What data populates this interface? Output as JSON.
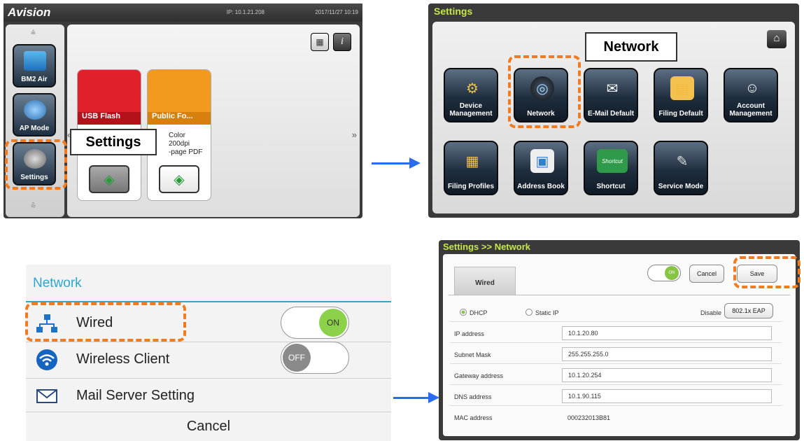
{
  "panel1": {
    "logo": "Avision",
    "ip": "IP: 10.1.21.208",
    "datetime": "2017/11/27 10:19",
    "sidebar": [
      {
        "label": "BM2 Air"
      },
      {
        "label": "AP Mode"
      },
      {
        "label": "Settings"
      }
    ],
    "tiles": [
      {
        "title": "USB Flash",
        "color": "#e0202a"
      },
      {
        "title": "Public Fo...",
        "color": "#f29a1e",
        "details": [
          "Color",
          "200dpi",
          "-page PDF"
        ]
      }
    ],
    "callout": "Settings",
    "nav_left": "«",
    "nav_right": "»"
  },
  "panel2": {
    "title": "Settings",
    "callout": "Network",
    "icons": [
      {
        "label": "Device Management",
        "glyph": "⚙"
      },
      {
        "label": "Network",
        "glyph": "◎"
      },
      {
        "label": "E-Mail Default",
        "glyph": "✉"
      },
      {
        "label": "Filing Default",
        "glyph": "▤"
      },
      {
        "label": "Account Management",
        "glyph": "☺"
      },
      {
        "label": "Filing Profiles",
        "glyph": "▦"
      },
      {
        "label": "Address Book",
        "glyph": "▣"
      },
      {
        "label": "Shortcut",
        "glyph": "➜",
        "sign": "Shortcut"
      },
      {
        "label": "Service Mode",
        "glyph": "✎"
      }
    ]
  },
  "panel3": {
    "title": "Network",
    "rows": [
      {
        "label": "Wired",
        "toggle": "ON"
      },
      {
        "label": "Wireless Client",
        "toggle": "OFF"
      },
      {
        "label": "Mail Server Setting"
      }
    ],
    "cancel": "Cancel"
  },
  "panel4": {
    "title": "Settings >> Network",
    "tab": "Wired",
    "toggle": "ON",
    "cancel": "Cancel",
    "save": "Save",
    "dhcp": "DHCP",
    "static_ip": "Static IP",
    "disable": "Disable",
    "eap": "802.1x EAP",
    "fields": [
      {
        "label": "IP address",
        "value": "10.1.20.80"
      },
      {
        "label": "Subnet Mask",
        "value": "255.255.255.0"
      },
      {
        "label": "Gateway address",
        "value": "10.1.20.254"
      },
      {
        "label": "DNS address",
        "value": "10.1.90.115"
      },
      {
        "label": "MAC address",
        "value": "000232013B81"
      }
    ]
  },
  "colors": {
    "accent_orange": "#f07b20",
    "arrow_blue": "#2a6cf0",
    "title_green": "#c6e84a",
    "network_blue": "#2ea6cc",
    "toggle_on": "#88c443"
  }
}
